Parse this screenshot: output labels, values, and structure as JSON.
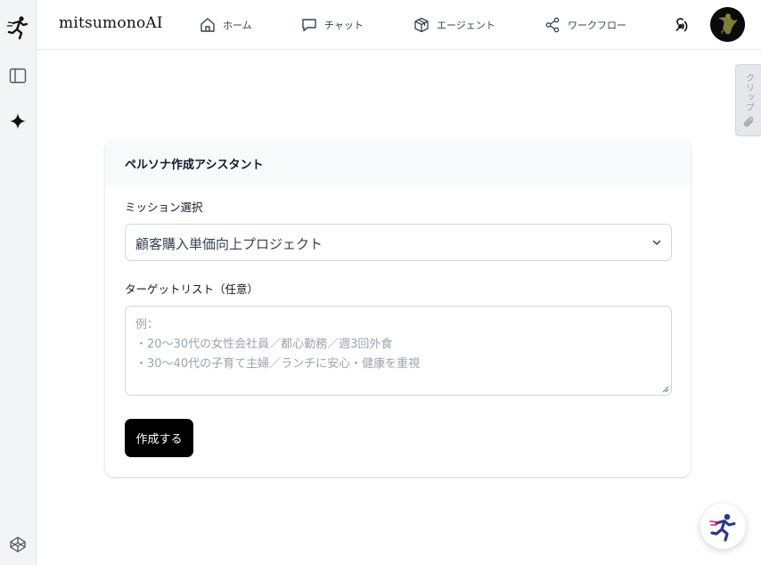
{
  "app": {
    "brand": "mitsumonoAI"
  },
  "nav": {
    "items": [
      {
        "label": "ホーム",
        "icon": "home-icon"
      },
      {
        "label": "チャット",
        "icon": "chat-icon"
      },
      {
        "label": "エージェント",
        "icon": "cube-icon"
      },
      {
        "label": "ワークフロー",
        "icon": "share-icon"
      }
    ]
  },
  "rail": {
    "icons": [
      "runner-logo-icon",
      "sidebar-toggle-icon",
      "sparkle-icon",
      "codepen-icon"
    ]
  },
  "clip": {
    "label": "クリップ"
  },
  "card": {
    "title": "ペルソナ作成アシスタント",
    "mission_label": "ミッション選択",
    "mission_value": "顧客購入単価向上プロジェクト",
    "target_label": "ターゲットリスト（任意）",
    "target_placeholder_lines": [
      "例：",
      "・20〜30代の女性会社員／都心勤務／週3回外食",
      "・30〜40代の子育て主婦／ランチに安心・健康を重視"
    ],
    "submit_label": "作成する"
  },
  "colors": {
    "accent": "#000000",
    "rail_bg": "#f3f4f6",
    "placeholder": "#9ca3af",
    "fab_figure": "#2b3a8f"
  }
}
